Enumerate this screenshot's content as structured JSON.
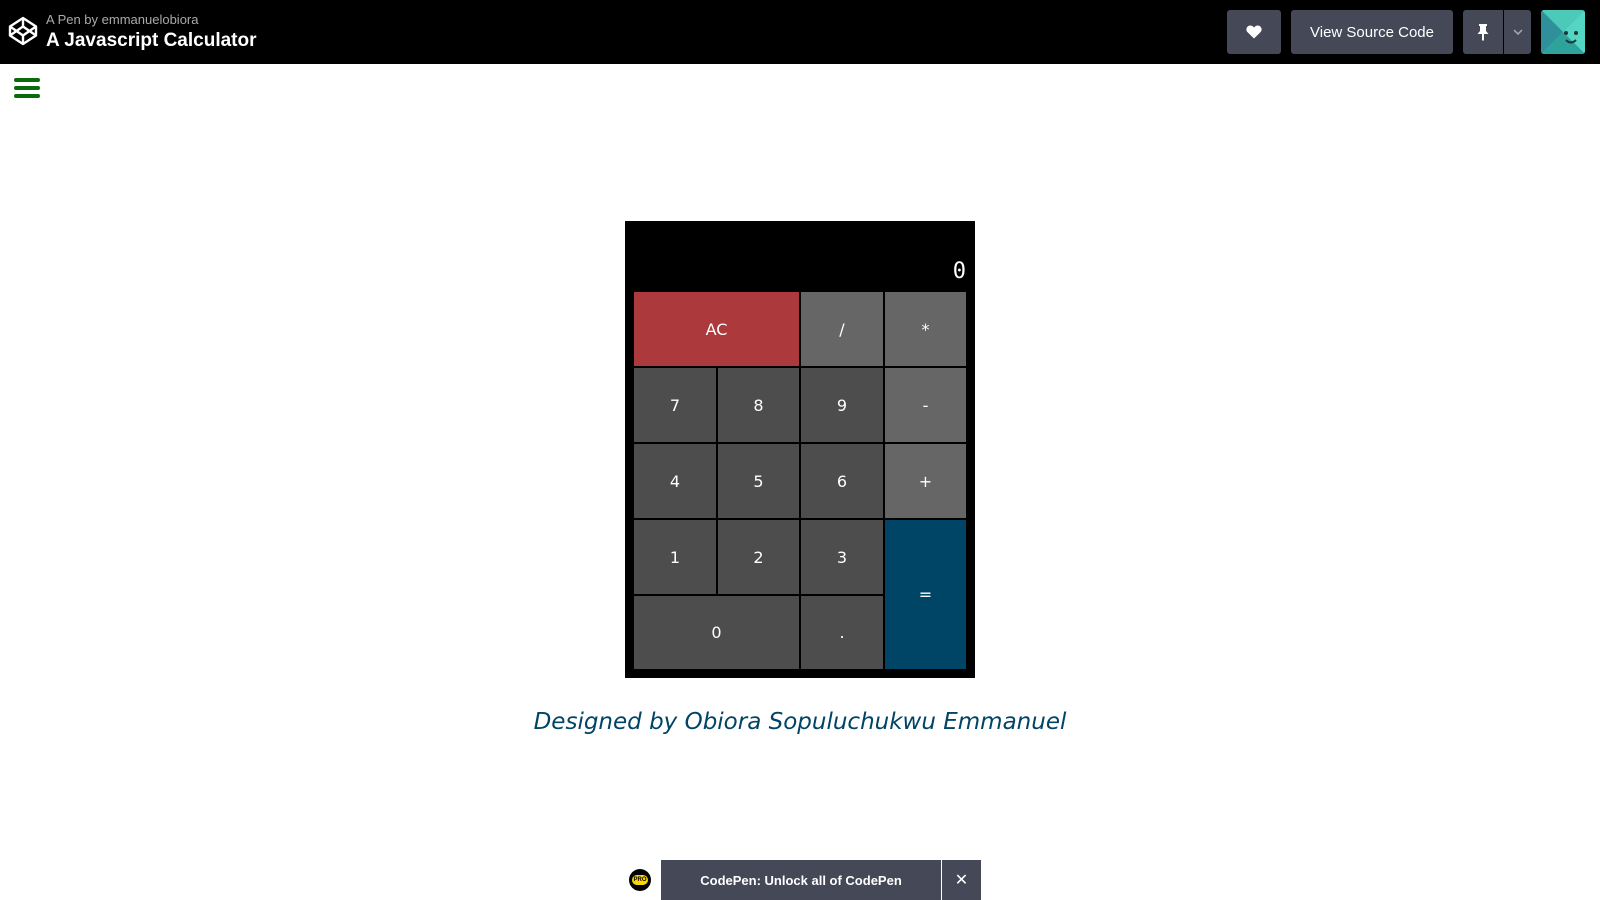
{
  "header": {
    "meta": "A Pen by emmanuelobiora",
    "title": "A Javascript Calculator",
    "view_source_label": "View Source Code",
    "logo_icon": "codepen-logo-icon",
    "heart_icon": "heart-icon",
    "pin_icon": "pin-icon",
    "caret_icon": "chevron-down-icon"
  },
  "menu_icon": "hamburger-menu-icon",
  "calculator": {
    "display": "0",
    "keys": {
      "ac": "AC",
      "divide": "/",
      "multiply": "*",
      "seven": "7",
      "eight": "8",
      "nine": "9",
      "minus": "-",
      "four": "4",
      "five": "5",
      "six": "6",
      "plus": "+",
      "one": "1",
      "two": "2",
      "three": "3",
      "equals": "=",
      "zero": "0",
      "decimal": "."
    },
    "colors": {
      "number": "#4d4d4d",
      "operator": "#666666",
      "clear": "#ac393b",
      "equals": "#004466"
    }
  },
  "credit": "Designed by Obiora Sopuluchukwu Emmanuel",
  "bottom_bar": {
    "pro_badge": "PRO",
    "unlock_label": "CodePen: Unlock all of CodePen",
    "close_label": "✕"
  }
}
